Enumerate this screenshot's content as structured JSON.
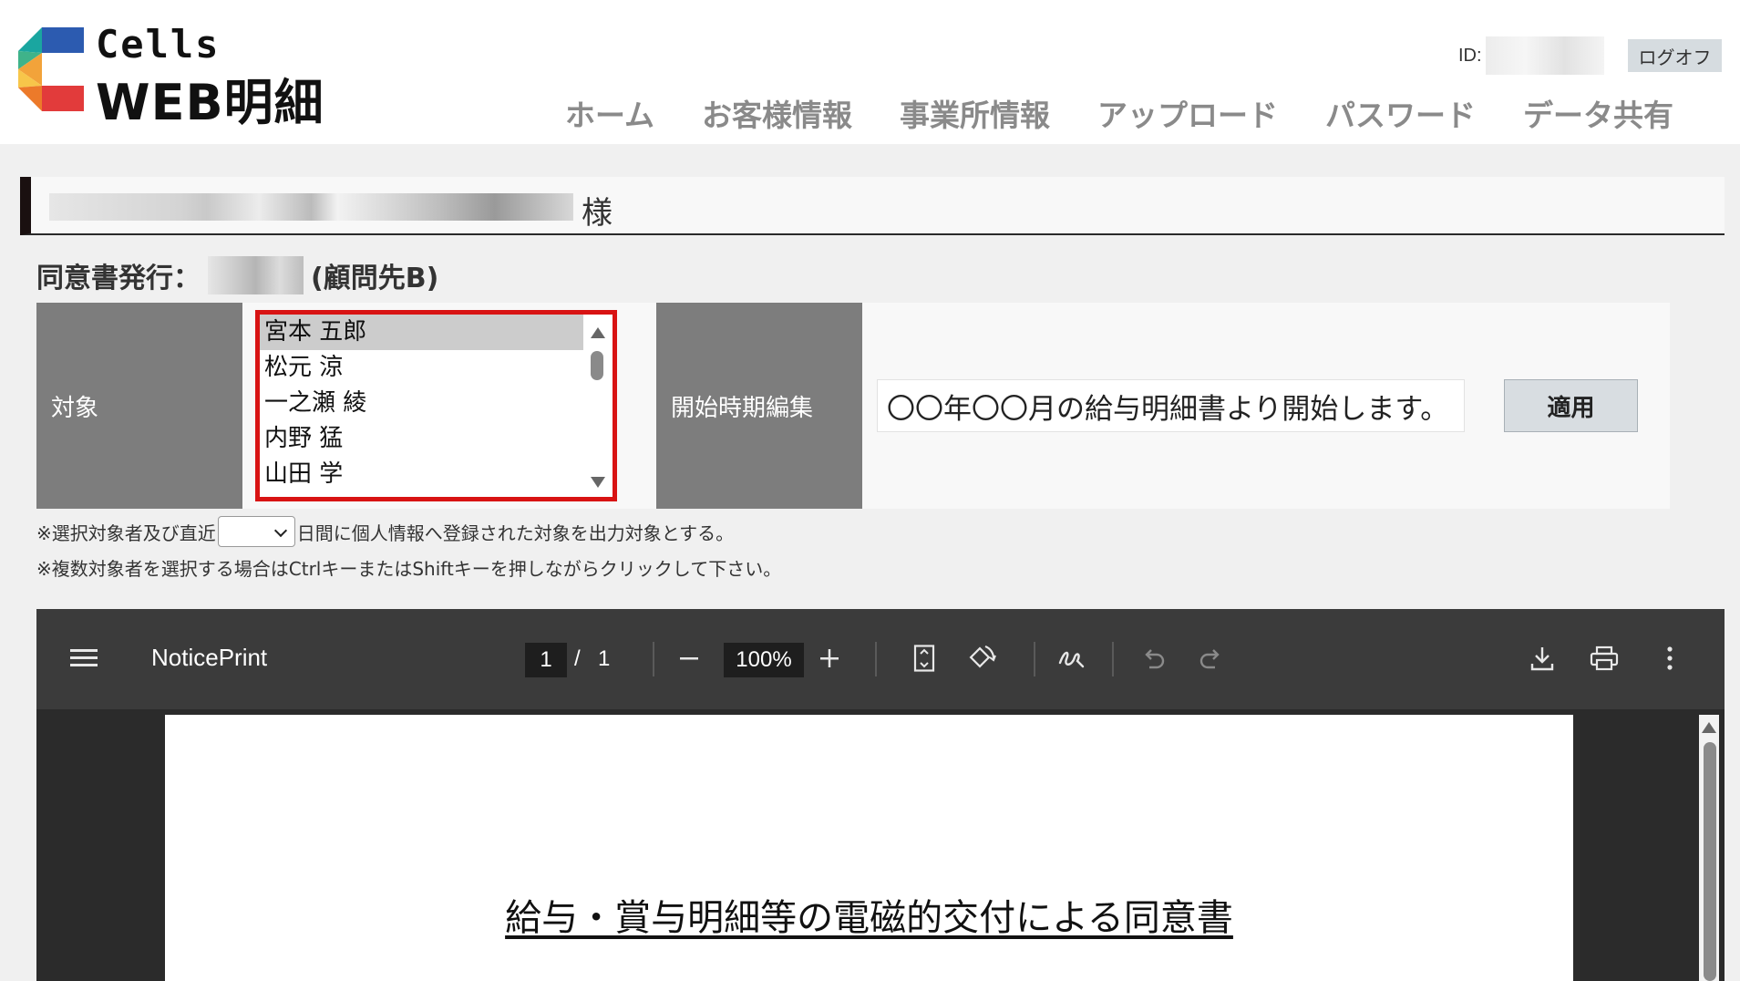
{
  "header": {
    "logo_line1": "Cells",
    "logo_line2": "WEB明細",
    "id_label": "ID:",
    "logout_label": "ログオフ",
    "nav": [
      "ホーム",
      "お客様情報",
      "事業所情報",
      "アップロード",
      "パスワード",
      "データ共有"
    ]
  },
  "customer": {
    "name_suffix": "様"
  },
  "consent": {
    "title_prefix": "同意書発行：",
    "title_suffix": "(顧問先B)",
    "target_label": "対象",
    "employees": [
      "宮本 五郎",
      "松元 涼",
      "一之瀬 綾",
      "内野 猛",
      "山田 学"
    ],
    "selected_employee": "宮本 五郎",
    "start_label": "開始時期編集",
    "start_value": "〇〇年〇〇月の給与明細書より開始します。",
    "apply_label": "適用",
    "note1_before": "※選択対象者及び直近",
    "note1_after": "日間に個人情報へ登録された対象を出力対象とする。",
    "note2": "※複数対象者を選択する場合はCtrlキーまたはShiftキーを押しながらクリックして下さい。"
  },
  "pdf": {
    "doc_name": "NoticePrint",
    "current_page": "1",
    "page_separator": "/",
    "total_pages": "1",
    "zoom": "100%",
    "document_title": "給与・賞与明細等の電磁的交付による同意書"
  },
  "colors": {
    "accent_red": "#d81313",
    "label_gray": "#7d7d7d",
    "toolbar_bg": "#3b3b3b"
  }
}
